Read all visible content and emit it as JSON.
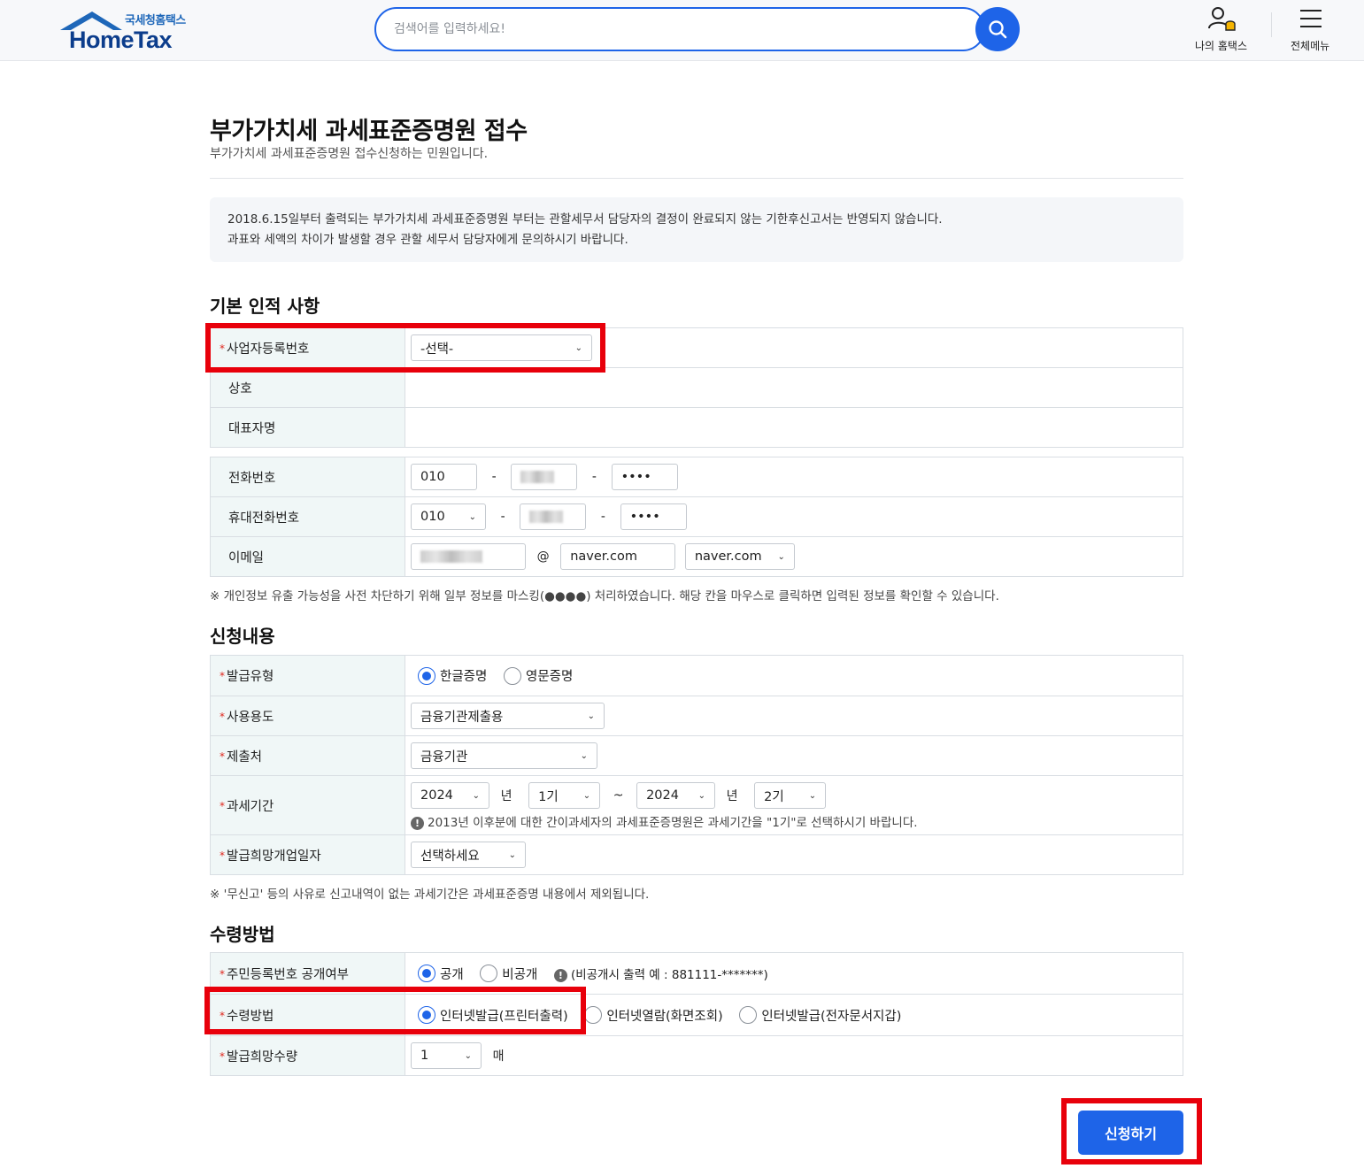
{
  "header": {
    "logo_sub": "국세청홈택스",
    "logo_main": "HomeTax",
    "search_placeholder": "검색어를 입력하세요!",
    "my_hometax": "나의 홈택스",
    "all_menu": "전체메뉴",
    "accent": "#1e64e8"
  },
  "page": {
    "title": "부가가치세 과세표준증명원 접수",
    "desc": "부가가치세 과세표준증명원 접수신청하는 민원입니다.",
    "notice_line1": "2018.6.15일부터 출력되는 부가가치세 과세표준증명원 부터는 관할세무서 담당자의 결정이 완료되지 않는 기한후신고서는 반영되지 않습니다.",
    "notice_line2": "과표와 세액의 차이가 발생할 경우 관할 세무서 담당자에게 문의하시기 바랍니다."
  },
  "basic": {
    "section_title": "기본 인적 사항",
    "biz_no_label": "사업자등록번호",
    "biz_no_value": "-선택-",
    "company_label": "상호",
    "ceo_label": "대표자명",
    "phone_label": "전화번호",
    "phone_1": "010",
    "phone_3": "••••",
    "mobile_label": "휴대전화번호",
    "mobile_1": "010",
    "mobile_3": "••••",
    "email_label": "이메일",
    "email_at": "@",
    "email_domain": "naver.com",
    "email_domain_select": "naver.com",
    "dash": "-",
    "footnote": "※ 개인정보 유출 가능성을 사전 차단하기 위해 일부 정보를 마스킹(●●●●) 처리하였습니다. 해당 칸을 마우스로 클릭하면 입력된 정보를 확인할 수 있습니다."
  },
  "apply": {
    "section_title": "신청내용",
    "type_label": "발급유형",
    "type_korean": "한글증명",
    "type_english": "영문증명",
    "purpose_label": "사용용도",
    "purpose_value": "금융기관제출용",
    "submit_to_label": "제출처",
    "submit_to_value": "금융기관",
    "period_label": "과세기간",
    "from_year": "2024",
    "year_unit": "년",
    "from_term": "1기",
    "tilde": "~",
    "to_year": "2024",
    "to_term": "2기",
    "period_note": "2013년 이후분에 대한 간이과세자의 과세표준증명원은 과세기간을 \"1기\"로 선택하시기 바랍니다.",
    "open_date_label": "발급희망개업일자",
    "open_date_value": "선택하세요",
    "footnote": "※ '무신고' 등의 사유로 신고내역이 없는 과세기간은 과세표준증명 내용에서 제외됩니다."
  },
  "receive": {
    "section_title": "수령방법",
    "rrn_label": "주민등록번호 공개여부",
    "rrn_public": "공개",
    "rrn_private": "비공개",
    "rrn_note": "(비공개시 출력 예 : 881111-*******)",
    "method_label": "수령방법",
    "method_print": "인터넷발급(프린터출력)",
    "method_view": "인터넷열람(화면조회)",
    "method_wallet": "인터넷발급(전자문서지갑)",
    "qty_label": "발급희망수량",
    "qty_value": "1",
    "qty_unit": "매"
  },
  "submit_label": "신청하기"
}
